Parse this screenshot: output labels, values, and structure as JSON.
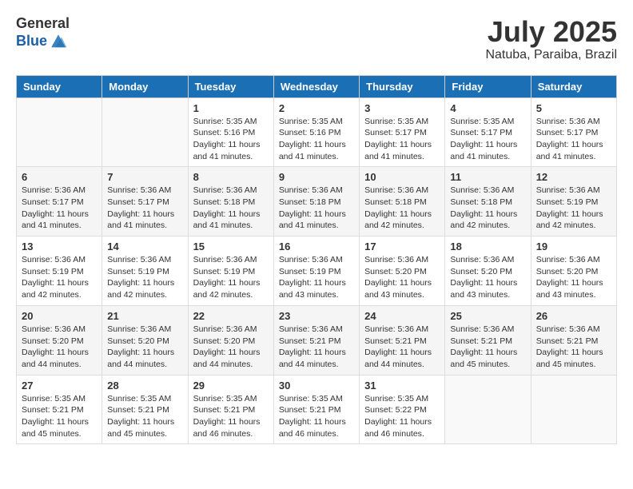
{
  "header": {
    "logo_general": "General",
    "logo_blue": "Blue",
    "month_title": "July 2025",
    "location": "Natuba, Paraiba, Brazil"
  },
  "calendar": {
    "days_of_week": [
      "Sunday",
      "Monday",
      "Tuesday",
      "Wednesday",
      "Thursday",
      "Friday",
      "Saturday"
    ],
    "weeks": [
      [
        {
          "day": "",
          "info": ""
        },
        {
          "day": "",
          "info": ""
        },
        {
          "day": "1",
          "info": "Sunrise: 5:35 AM\nSunset: 5:16 PM\nDaylight: 11 hours and 41 minutes."
        },
        {
          "day": "2",
          "info": "Sunrise: 5:35 AM\nSunset: 5:16 PM\nDaylight: 11 hours and 41 minutes."
        },
        {
          "day": "3",
          "info": "Sunrise: 5:35 AM\nSunset: 5:17 PM\nDaylight: 11 hours and 41 minutes."
        },
        {
          "day": "4",
          "info": "Sunrise: 5:35 AM\nSunset: 5:17 PM\nDaylight: 11 hours and 41 minutes."
        },
        {
          "day": "5",
          "info": "Sunrise: 5:36 AM\nSunset: 5:17 PM\nDaylight: 11 hours and 41 minutes."
        }
      ],
      [
        {
          "day": "6",
          "info": "Sunrise: 5:36 AM\nSunset: 5:17 PM\nDaylight: 11 hours and 41 minutes."
        },
        {
          "day": "7",
          "info": "Sunrise: 5:36 AM\nSunset: 5:17 PM\nDaylight: 11 hours and 41 minutes."
        },
        {
          "day": "8",
          "info": "Sunrise: 5:36 AM\nSunset: 5:18 PM\nDaylight: 11 hours and 41 minutes."
        },
        {
          "day": "9",
          "info": "Sunrise: 5:36 AM\nSunset: 5:18 PM\nDaylight: 11 hours and 41 minutes."
        },
        {
          "day": "10",
          "info": "Sunrise: 5:36 AM\nSunset: 5:18 PM\nDaylight: 11 hours and 42 minutes."
        },
        {
          "day": "11",
          "info": "Sunrise: 5:36 AM\nSunset: 5:18 PM\nDaylight: 11 hours and 42 minutes."
        },
        {
          "day": "12",
          "info": "Sunrise: 5:36 AM\nSunset: 5:19 PM\nDaylight: 11 hours and 42 minutes."
        }
      ],
      [
        {
          "day": "13",
          "info": "Sunrise: 5:36 AM\nSunset: 5:19 PM\nDaylight: 11 hours and 42 minutes."
        },
        {
          "day": "14",
          "info": "Sunrise: 5:36 AM\nSunset: 5:19 PM\nDaylight: 11 hours and 42 minutes."
        },
        {
          "day": "15",
          "info": "Sunrise: 5:36 AM\nSunset: 5:19 PM\nDaylight: 11 hours and 42 minutes."
        },
        {
          "day": "16",
          "info": "Sunrise: 5:36 AM\nSunset: 5:19 PM\nDaylight: 11 hours and 43 minutes."
        },
        {
          "day": "17",
          "info": "Sunrise: 5:36 AM\nSunset: 5:20 PM\nDaylight: 11 hours and 43 minutes."
        },
        {
          "day": "18",
          "info": "Sunrise: 5:36 AM\nSunset: 5:20 PM\nDaylight: 11 hours and 43 minutes."
        },
        {
          "day": "19",
          "info": "Sunrise: 5:36 AM\nSunset: 5:20 PM\nDaylight: 11 hours and 43 minutes."
        }
      ],
      [
        {
          "day": "20",
          "info": "Sunrise: 5:36 AM\nSunset: 5:20 PM\nDaylight: 11 hours and 44 minutes."
        },
        {
          "day": "21",
          "info": "Sunrise: 5:36 AM\nSunset: 5:20 PM\nDaylight: 11 hours and 44 minutes."
        },
        {
          "day": "22",
          "info": "Sunrise: 5:36 AM\nSunset: 5:20 PM\nDaylight: 11 hours and 44 minutes."
        },
        {
          "day": "23",
          "info": "Sunrise: 5:36 AM\nSunset: 5:21 PM\nDaylight: 11 hours and 44 minutes."
        },
        {
          "day": "24",
          "info": "Sunrise: 5:36 AM\nSunset: 5:21 PM\nDaylight: 11 hours and 44 minutes."
        },
        {
          "day": "25",
          "info": "Sunrise: 5:36 AM\nSunset: 5:21 PM\nDaylight: 11 hours and 45 minutes."
        },
        {
          "day": "26",
          "info": "Sunrise: 5:36 AM\nSunset: 5:21 PM\nDaylight: 11 hours and 45 minutes."
        }
      ],
      [
        {
          "day": "27",
          "info": "Sunrise: 5:35 AM\nSunset: 5:21 PM\nDaylight: 11 hours and 45 minutes."
        },
        {
          "day": "28",
          "info": "Sunrise: 5:35 AM\nSunset: 5:21 PM\nDaylight: 11 hours and 45 minutes."
        },
        {
          "day": "29",
          "info": "Sunrise: 5:35 AM\nSunset: 5:21 PM\nDaylight: 11 hours and 46 minutes."
        },
        {
          "day": "30",
          "info": "Sunrise: 5:35 AM\nSunset: 5:21 PM\nDaylight: 11 hours and 46 minutes."
        },
        {
          "day": "31",
          "info": "Sunrise: 5:35 AM\nSunset: 5:22 PM\nDaylight: 11 hours and 46 minutes."
        },
        {
          "day": "",
          "info": ""
        },
        {
          "day": "",
          "info": ""
        }
      ]
    ]
  }
}
